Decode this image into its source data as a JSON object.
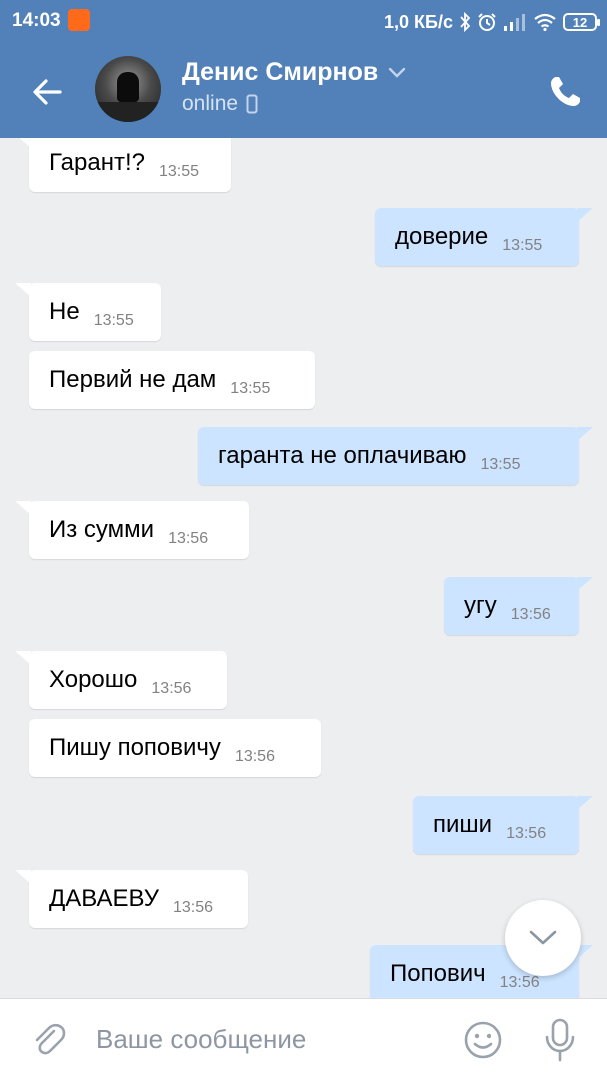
{
  "status_bar": {
    "time": "14:03",
    "network_speed": "1,0 КБ/с",
    "battery_level": "12"
  },
  "header": {
    "contact_name": "Денис Смирнов",
    "status": "online"
  },
  "messages": [
    {
      "direction": "in",
      "text": "Гарант!?",
      "time": "13:55"
    },
    {
      "direction": "out",
      "text": "доверие",
      "time": "13:55"
    },
    {
      "direction": "in",
      "text": "Не",
      "time": "13:55"
    },
    {
      "direction": "in",
      "text": "Первий не дам",
      "time": "13:55"
    },
    {
      "direction": "out",
      "text": "гаранта не оплачиваю",
      "time": "13:55"
    },
    {
      "direction": "in",
      "text": "Из сумми",
      "time": "13:56"
    },
    {
      "direction": "out",
      "text": "угу",
      "time": "13:56"
    },
    {
      "direction": "in",
      "text": "Хорошо",
      "time": "13:56"
    },
    {
      "direction": "in",
      "text": "Пишу поповичу",
      "time": "13:56"
    },
    {
      "direction": "out",
      "text": "пиши",
      "time": "13:56"
    },
    {
      "direction": "in",
      "text": "ДАВАЕВУ",
      "time": "13:56"
    },
    {
      "direction": "out",
      "text": "Попович",
      "time": "13:56"
    }
  ],
  "composer": {
    "placeholder": "Ваше сообщение"
  },
  "icons": {
    "back": "arrow-left-icon",
    "call": "phone-icon",
    "attach": "paperclip-icon",
    "emoji": "smile-icon",
    "mic": "microphone-icon",
    "scroll_down": "chevron-down-icon"
  },
  "colors": {
    "header_bg": "#5181b8",
    "chat_bg": "#edeef0",
    "incoming_bubble": "#ffffff",
    "outgoing_bubble": "#cce4ff",
    "time_text": "#828282"
  }
}
